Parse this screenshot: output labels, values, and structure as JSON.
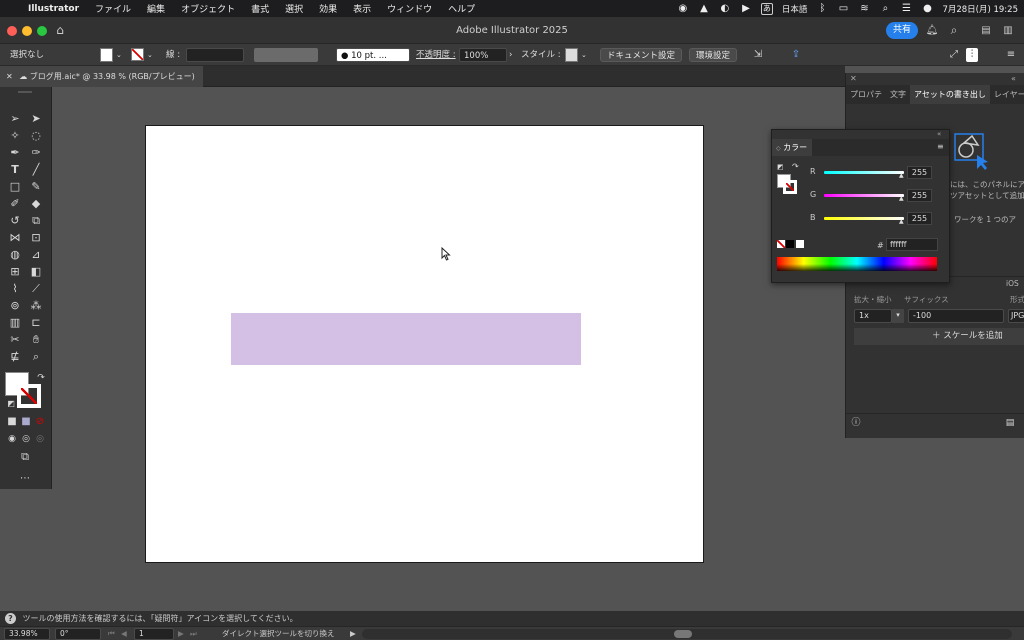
{
  "menubar": {
    "apple_icon": "apple-icon",
    "app": "Illustrator",
    "items": [
      "ファイル",
      "編集",
      "オブジェクト",
      "書式",
      "選択",
      "効果",
      "表示",
      "ウィンドウ",
      "ヘルプ"
    ],
    "input_source": "日本語",
    "input_glyph": "あ",
    "datetime": "7月28日(月)  19:25"
  },
  "titlebar": {
    "title": "Adobe Illustrator 2025",
    "share_label": "共有"
  },
  "control_bar": {
    "selection": "選択なし",
    "stroke_label": "線 :",
    "brush_value": "10 pt. ...",
    "opacity_label": "不透明度 :",
    "opacity_value": "100%",
    "style_label": "スタイル :",
    "doc_settings": "ドキュメント設定",
    "preferences": "環境設定"
  },
  "document_tab": {
    "name": "ブログ用.aic* @ 33.98 % (RGB/プレビュー)"
  },
  "color_panel": {
    "title": "カラー",
    "r_label": "R",
    "r_value": "255",
    "g_label": "G",
    "g_value": "255",
    "b_label": "B",
    "b_value": "255",
    "hex_label": "#",
    "hex_value": "ffffff"
  },
  "right_panel": {
    "tabs": [
      "プロパテ",
      "文字",
      "アセットの書き出し",
      "レイヤー"
    ],
    "desc_line1": "には、このパネルにア",
    "desc_line2": "ツアセットとして追加",
    "desc_line3": "ワークを 1 つのア",
    "ios_label": "iOS",
    "scale_label": "拡大・縮小",
    "suffix_label": "サフィックス",
    "format_label": "形式",
    "scale_value": "1x",
    "suffix_value": "-100",
    "format_value": "JPG",
    "add_scale": "スケールを追加"
  },
  "help_bar": {
    "text": "ツールの使用方法を確認するには、「疑問符」アイコンを選択してください。"
  },
  "status_bar": {
    "zoom": "33.98%",
    "rotate": "0°",
    "page": "1",
    "tool_status": "ダイレクト選択ツールを切り換え"
  },
  "colors": {
    "rect_fill": "#d4bfe5",
    "accent": "#2680eb"
  }
}
